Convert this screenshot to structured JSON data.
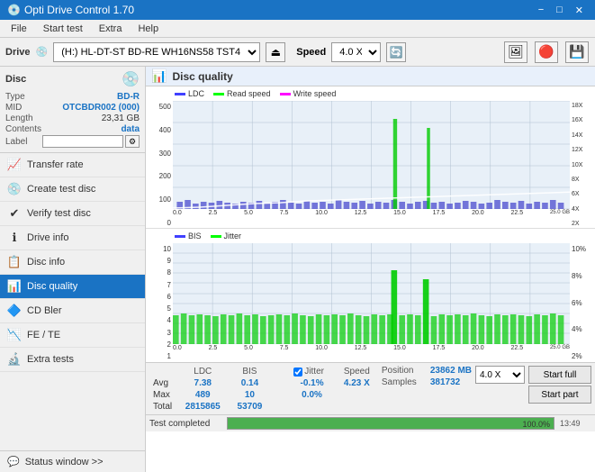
{
  "titlebar": {
    "title": "Opti Drive Control 1.70",
    "minimize": "−",
    "maximize": "□",
    "close": "✕"
  },
  "menubar": {
    "items": [
      "File",
      "Start test",
      "Extra",
      "Help"
    ]
  },
  "drivebar": {
    "label": "Drive",
    "drive_name": "(H:) HL-DT-ST BD-RE  WH16NS58 TST4",
    "speed_label": "Speed",
    "speed_value": "4.0 X"
  },
  "disc": {
    "title": "Disc",
    "type_label": "Type",
    "type_value": "BD-R",
    "mid_label": "MID",
    "mid_value": "OTCBDR002 (000)",
    "length_label": "Length",
    "length_value": "23,31 GB",
    "contents_label": "Contents",
    "contents_value": "data",
    "label_label": "Label"
  },
  "nav": {
    "items": [
      {
        "id": "transfer-rate",
        "label": "Transfer rate",
        "icon": "📈"
      },
      {
        "id": "create-test-disc",
        "label": "Create test disc",
        "icon": "💿"
      },
      {
        "id": "verify-test-disc",
        "label": "Verify test disc",
        "icon": "✅"
      },
      {
        "id": "drive-info",
        "label": "Drive info",
        "icon": "ℹ️"
      },
      {
        "id": "disc-info",
        "label": "Disc info",
        "icon": "📋"
      },
      {
        "id": "disc-quality",
        "label": "Disc quality",
        "icon": "📊",
        "active": true
      },
      {
        "id": "cd-bler",
        "label": "CD Bler",
        "icon": "🔷"
      },
      {
        "id": "fe-te",
        "label": "FE / TE",
        "icon": "📉"
      },
      {
        "id": "extra-tests",
        "label": "Extra tests",
        "icon": "🔬"
      }
    ],
    "status_window": "Status window >>"
  },
  "disc_quality": {
    "title": "Disc quality",
    "legend": {
      "ldc": "LDC",
      "read_speed": "Read speed",
      "write_speed": "Write speed",
      "bis": "BIS",
      "jitter": "Jitter"
    },
    "top_chart": {
      "y_left": [
        "500",
        "400",
        "300",
        "200",
        "100",
        "0"
      ],
      "y_right": [
        "18X",
        "16X",
        "14X",
        "12X",
        "10X",
        "8X",
        "6X",
        "4X",
        "2X"
      ],
      "x": [
        "0.0",
        "2.5",
        "5.0",
        "7.5",
        "10.0",
        "12.5",
        "15.0",
        "17.5",
        "20.0",
        "22.5",
        "25.0 GB"
      ]
    },
    "bottom_chart": {
      "y_left": [
        "10",
        "9",
        "8",
        "7",
        "6",
        "5",
        "4",
        "3",
        "2",
        "1"
      ],
      "y_right": [
        "10%",
        "8%",
        "6%",
        "4%",
        "2%"
      ],
      "x": [
        "0.0",
        "2.5",
        "5.0",
        "7.5",
        "10.0",
        "12.5",
        "15.0",
        "17.5",
        "20.0",
        "22.5",
        "25.0 GB"
      ]
    }
  },
  "stats": {
    "columns": [
      "LDC",
      "BIS",
      "",
      "Jitter",
      "Speed"
    ],
    "jitter_checked": true,
    "jitter_label": "Jitter",
    "rows": [
      {
        "label": "Avg",
        "ldc": "7.38",
        "bis": "0.14",
        "jitter": "-0.1%",
        "speed_label": "Position",
        "speed_value": "4.23 X",
        "speed_select": "4.0 X",
        "pos_value": "23862 MB"
      },
      {
        "label": "Max",
        "ldc": "489",
        "bis": "10",
        "jitter": "0.0%",
        "speed_label": "Samples",
        "speed_value": "",
        "pos_value": "381732"
      },
      {
        "label": "Total",
        "ldc": "2815865",
        "bis": "53709",
        "jitter": ""
      }
    ],
    "buttons": {
      "start_full": "Start full",
      "start_part": "Start part"
    },
    "progress": {
      "value": 100,
      "text": "100.0%"
    },
    "status": "Test completed"
  }
}
